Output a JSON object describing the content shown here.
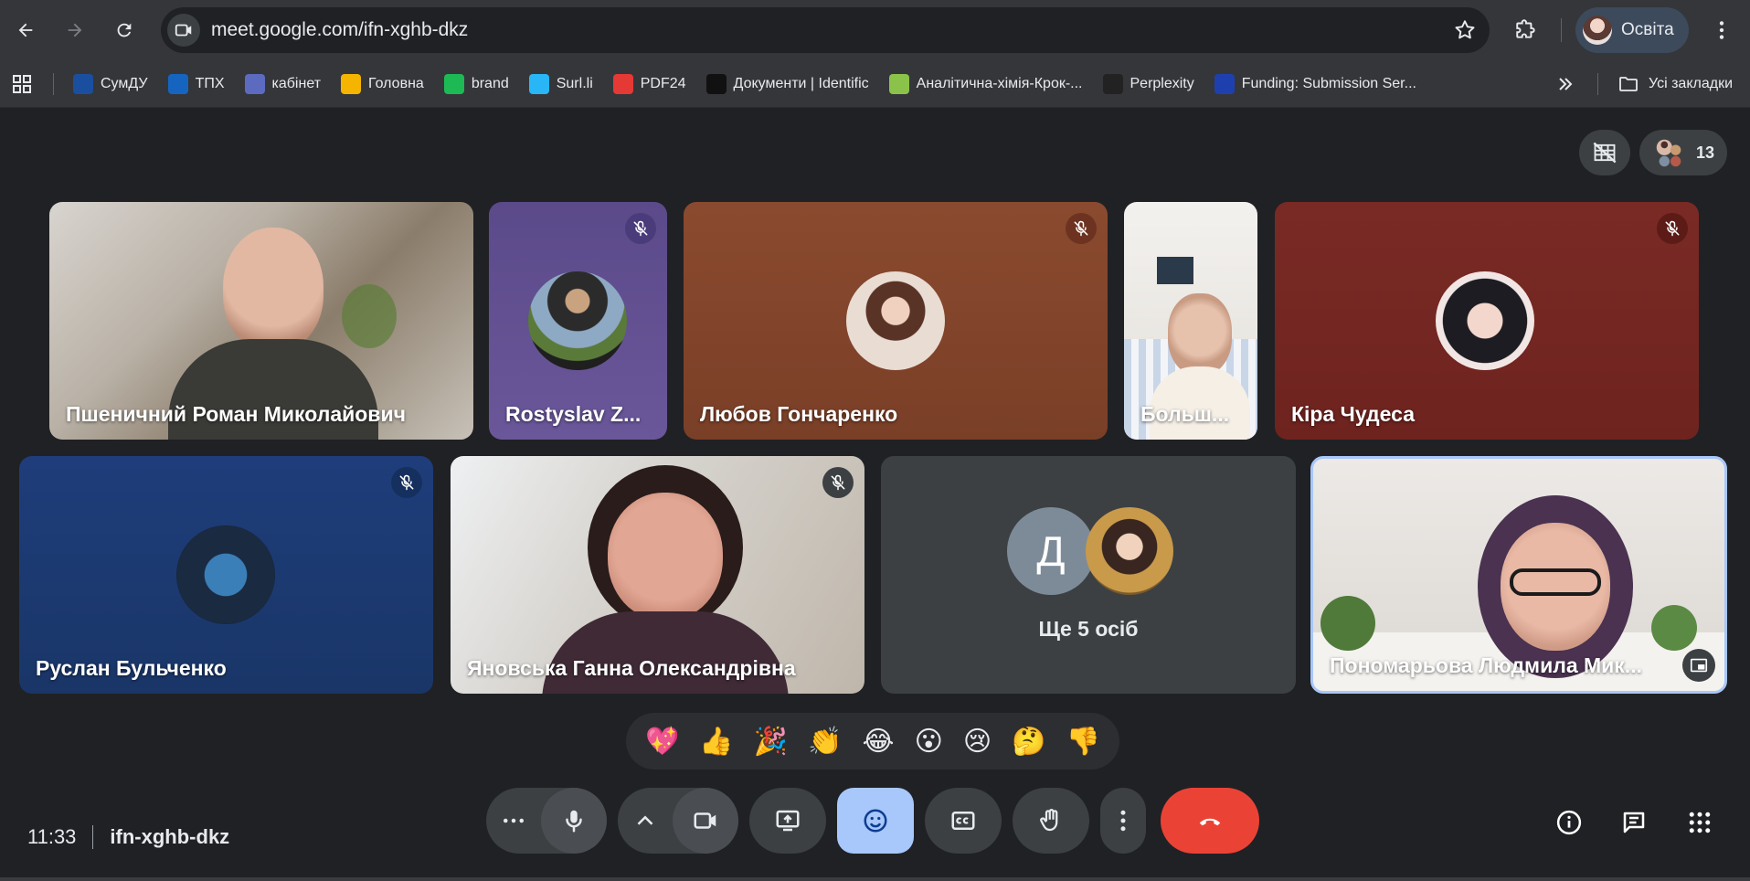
{
  "browser": {
    "url": "meet.google.com/ifn-xghb-dkz",
    "profile_name": "Освіта"
  },
  "bookmarks": [
    {
      "label": "СумДУ",
      "icon": "sumdu-icon",
      "color": "#1a4fa0"
    },
    {
      "label": "ТПХ",
      "icon": "letter-u-icon",
      "color": "#1565c0"
    },
    {
      "label": "кабінет",
      "icon": "person-icon",
      "color": "#5c6bc0"
    },
    {
      "label": "Головна",
      "icon": "classroom-icon",
      "color": "#f4b400"
    },
    {
      "label": "brand",
      "icon": "brand-icon",
      "color": "#1db954"
    },
    {
      "label": "Surl.li",
      "icon": "link-icon",
      "color": "#29b6f6"
    },
    {
      "label": "PDF24",
      "icon": "pdf24-icon",
      "color": "#e53935"
    },
    {
      "label": "Документи | Identific",
      "icon": "id-icon",
      "color": "#111111"
    },
    {
      "label": "Аналітична-хімія-Крок-...",
      "icon": "emblem-icon",
      "color": "#8bc34a"
    },
    {
      "label": "Perplexity",
      "icon": "perplexity-icon",
      "color": "#222222"
    },
    {
      "label": "Funding: Submission Ser...",
      "icon": "eu-icon",
      "color": "#1e40af"
    }
  ],
  "all_bookmarks_label": "Усі закладки",
  "meeting": {
    "participant_count": "13",
    "time": "11:33",
    "code": "ifn-xghb-dkz",
    "others_label": "Ще 5 осіб",
    "others_initial": "Д"
  },
  "participants": [
    {
      "name": "Пшеничний Роман Миколайович",
      "muted": false,
      "type": "video"
    },
    {
      "name": "Rostyslav Z...",
      "muted": true,
      "type": "avatar"
    },
    {
      "name": "Любов Гончаренко",
      "muted": true,
      "type": "avatar"
    },
    {
      "name": "Больш...",
      "muted": false,
      "type": "video"
    },
    {
      "name": "Кіра Чудеса",
      "muted": true,
      "type": "avatar"
    },
    {
      "name": "Руслан Бульченко",
      "muted": true,
      "type": "avatar"
    },
    {
      "name": "Яновська Ганна Олександрівна",
      "muted": true,
      "type": "video"
    },
    {
      "name": "Пономарьова Людмила Мик...",
      "muted": false,
      "type": "video"
    }
  ],
  "reactions": [
    "💖",
    "👍",
    "🎉",
    "👏",
    "😂",
    "😮",
    "😢",
    "🤔",
    "👎"
  ],
  "colors": {
    "background": "#202124",
    "control": "#3c4043",
    "end_call": "#ea4335",
    "active_control": "#a8c7fa",
    "mute_badge_purple": "#4a3b7a",
    "mute_badge_brown": "#6d3320"
  }
}
